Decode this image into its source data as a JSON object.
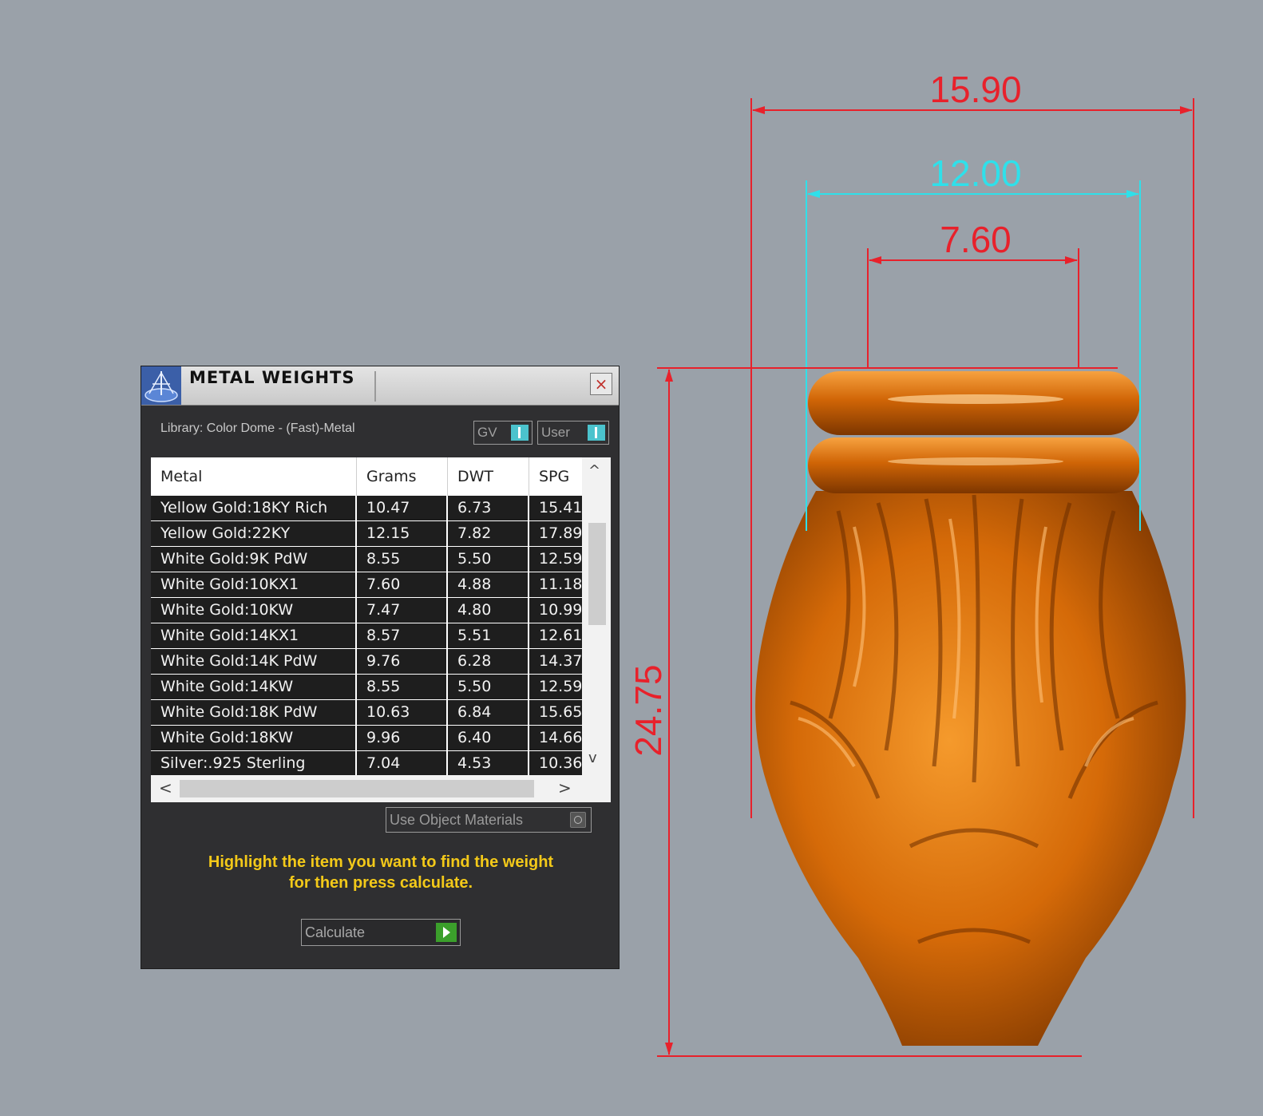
{
  "viewport": {
    "dimensions": {
      "overall_width": "15.90",
      "top_width": "12.00",
      "inner_width": "7.60",
      "height": "24.75"
    },
    "colors": {
      "background": "#9aa1a9",
      "dim_red": "#e8212b",
      "dim_cyan": "#2fe0ea",
      "model_orange": "#d66a09"
    }
  },
  "panel": {
    "title": "METAL WEIGHTS",
    "close_icon": "×",
    "library_label": "Library: Color Dome - (Fast)-Metal",
    "toggles": {
      "gv": "GV",
      "user": "User"
    },
    "table": {
      "headers": [
        "Metal",
        "Grams",
        "DWT",
        "SPG"
      ],
      "rows": [
        [
          "Yellow Gold:18KY Rich",
          "10.47",
          "6.73",
          "15.41"
        ],
        [
          "Yellow Gold:22KY",
          "12.15",
          "7.82",
          "17.89"
        ],
        [
          "White Gold:9K PdW",
          "8.55",
          "5.50",
          "12.59"
        ],
        [
          "White Gold:10KX1",
          "7.60",
          "4.88",
          "11.18"
        ],
        [
          "White Gold:10KW",
          "7.47",
          "4.80",
          "10.99"
        ],
        [
          "White Gold:14KX1",
          "8.57",
          "5.51",
          "12.61"
        ],
        [
          "White Gold:14K PdW",
          "9.76",
          "6.28",
          "14.37"
        ],
        [
          "White Gold:14KW",
          "8.55",
          "5.50",
          "12.59"
        ],
        [
          "White Gold:18K PdW",
          "10.63",
          "6.84",
          "15.65"
        ],
        [
          "White Gold:18KW",
          "9.96",
          "6.40",
          "14.66"
        ],
        [
          "Silver:.925 Sterling",
          "7.04",
          "4.53",
          "10.36"
        ]
      ]
    },
    "scroll_icons": {
      "up": "^",
      "down": "v",
      "left": "<",
      "right": ">"
    },
    "use_object_materials": "Use Object Materials",
    "hint_line1": "Highlight the item you want to find the weight",
    "hint_line2": "for then press calculate.",
    "calculate_label": "Calculate",
    "colors": {
      "panel_bg": "#2f2f31",
      "hint": "#f3c919",
      "toggle_knob": "#4bc3cd",
      "calculate_play": "#3b9f2b"
    }
  }
}
